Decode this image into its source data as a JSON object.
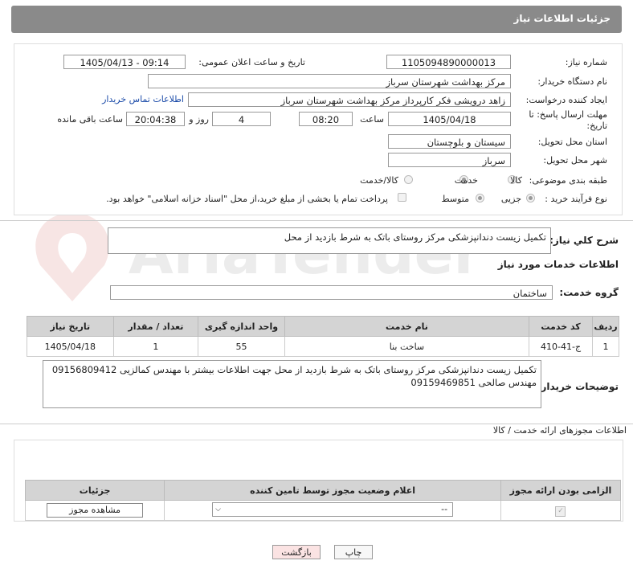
{
  "header": {
    "title": "جزئیات اطلاعات نیاز"
  },
  "form": {
    "need_number_label": "شماره نیاز:",
    "need_number": "1105094890000013",
    "announce_label": "تاریخ و ساعت اعلان عمومی:",
    "announce_value": "1405/04/13 - 09:14",
    "buyer_org_label": "نام دستگاه خریدار:",
    "buyer_org": "مرکز بهداشت شهرستان سرباز",
    "requester_label": "ایجاد کننده درخواست:",
    "requester": "زاهد درویشی فکر کارپرداز مرکز بهداشت شهرستان سرباز",
    "buyer_contact_link": "اطلاعات تماس خریدار",
    "deadline_label": "مهلت ارسال پاسخ: تا تاریخ:",
    "deadline_date": "1405/04/18",
    "time_label": "ساعت",
    "deadline_time": "08:20",
    "days_value": "4",
    "days_label": "روز و",
    "remaining_time": "20:04:38",
    "remaining_label": "ساعت باقی مانده",
    "province_label": "استان محل تحویل:",
    "province": "سیستان و بلوچستان",
    "city_label": "شهر محل تحویل:",
    "city": "سرباز",
    "category_label": "طبقه بندی موضوعی:",
    "category_options": [
      "کالا",
      "خدمت",
      "کالا/خدمت"
    ],
    "category_selected": "خدمت",
    "process_label": "نوع فرآیند خرید :",
    "process_options": [
      "جزیی",
      "متوسط"
    ],
    "process_selected": "جزیی",
    "payment_note": "پرداخت تمام یا بخشی از مبلغ خرید،از محل \"اسناد خزانه اسلامی\" خواهد بود."
  },
  "summary": {
    "label": "شرح کلي نياز:",
    "text": "تکمیل زیست دندانپزشکی مرکز روستای باتک به شرط بازدید از محل"
  },
  "services": {
    "section_title": "اطلاعات خدمات مورد نیاز",
    "group_label": "گروه خدمت:",
    "group_value": "ساختمان",
    "columns": [
      "ردیف",
      "کد خدمت",
      "نام خدمت",
      "واحد اندازه گیری",
      "تعداد / مقدار",
      "تاریخ نیاز"
    ],
    "rows": [
      [
        "1",
        "ج-41-410",
        "ساخت بنا",
        "55",
        "1",
        "1405/04/18"
      ]
    ]
  },
  "buyer_notes": {
    "label": "توضیحات خریدار:",
    "text": "تکمیل زیست دندانپزشکی مرکز روستای باتک به شرط بازدید از محل جهت اطلاعات بیشتر با مهندس کمالزیی 09156809412 مهندس صالحی 09159469851"
  },
  "permits": {
    "section_title": "اطلاعات مجوزهای ارائه خدمت / کالا",
    "columns": [
      "الزامی بودن ارائه مجوز",
      "اعلام وضعیت مجوز توسط تامین کننده",
      "جزئیات"
    ],
    "select_value": "--",
    "view_button": "مشاهده مجوز"
  },
  "footer": {
    "print_button": "چاپ",
    "back_button": "بازگشت"
  },
  "watermark": {
    "text": "AriaTender.neT"
  }
}
